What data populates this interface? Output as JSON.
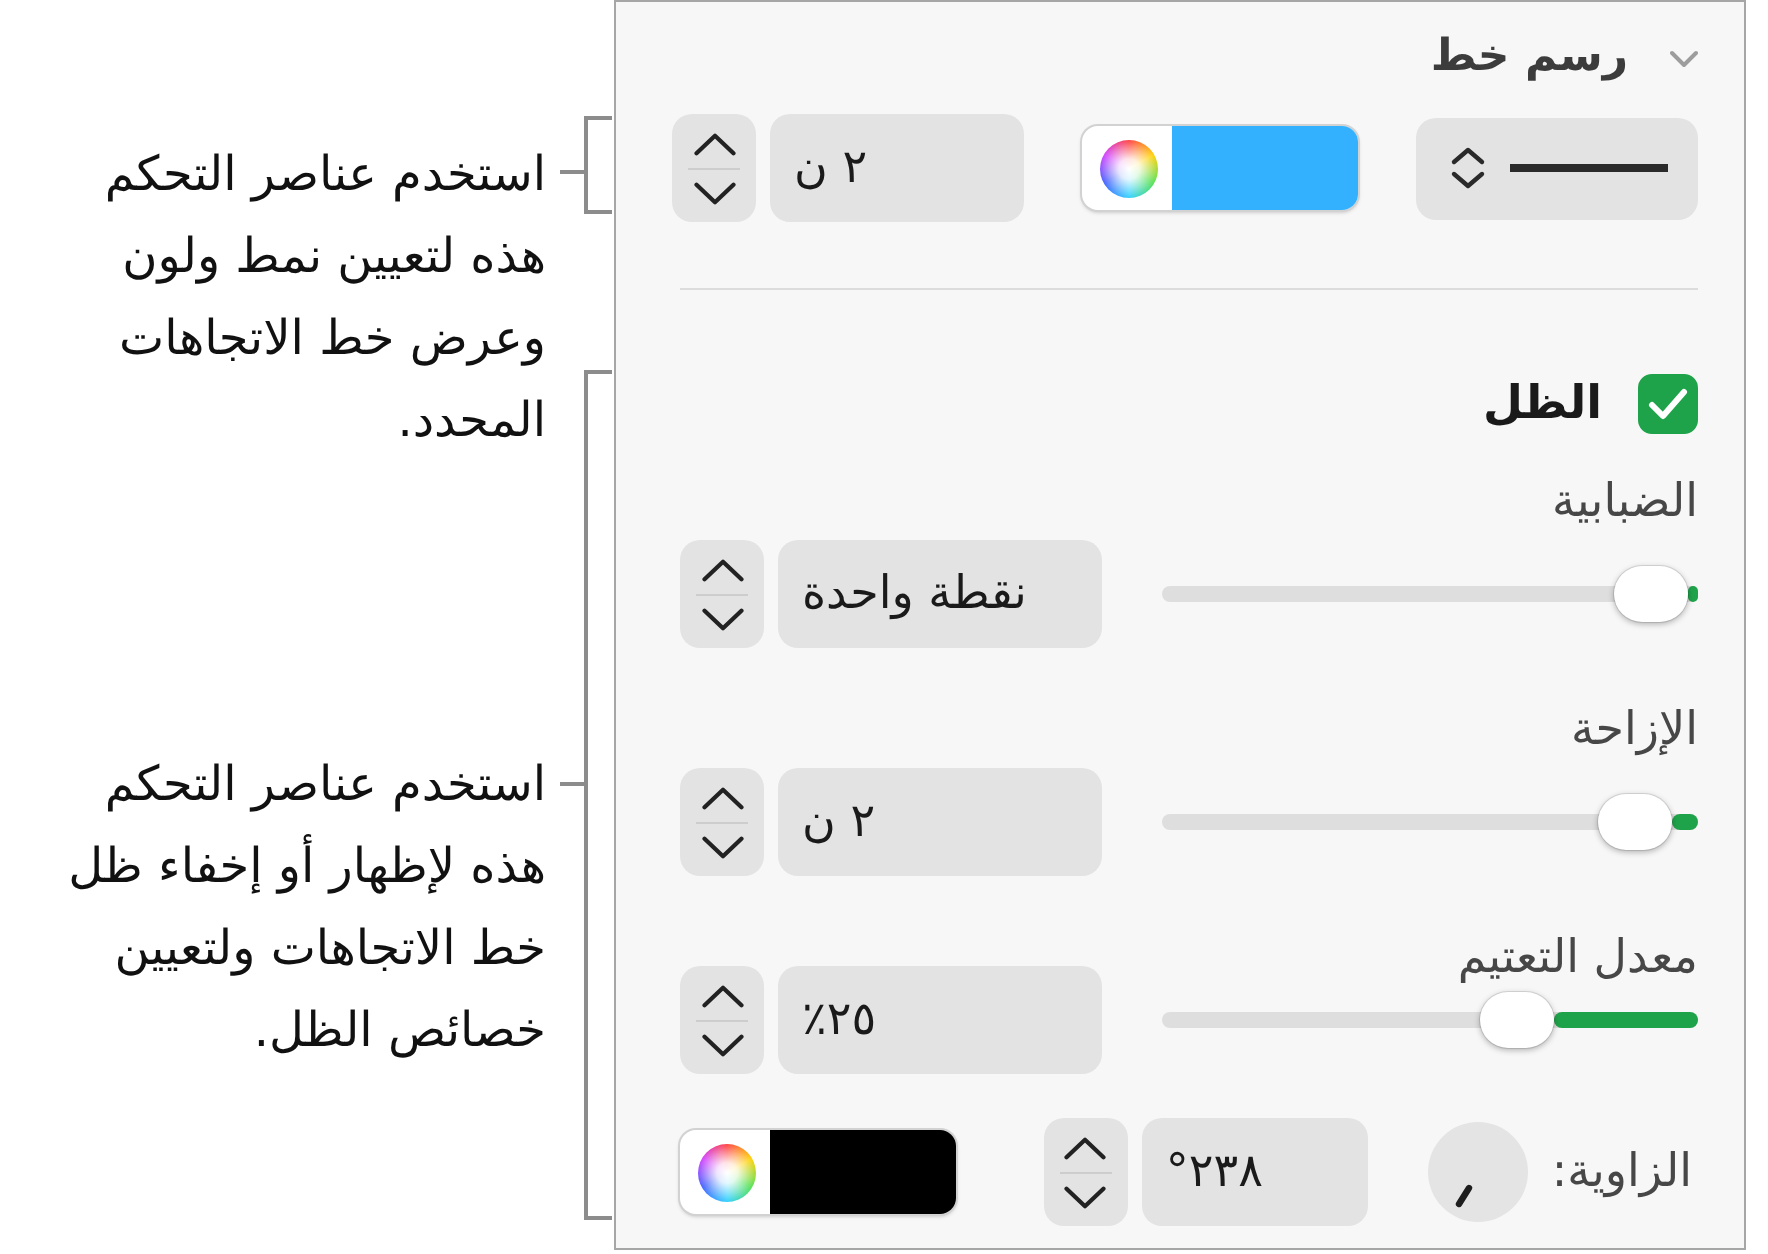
{
  "callouts": [
    {
      "text": "استخدم عناصر التحكم\nهذه لتعيين نمط ولون\nوعرض خط الاتجاهات\nالمحدد."
    },
    {
      "text": "استخدم عناصر التحكم\nهذه لإظهار أو إخفاء ظل\nخط الاتجاهات ولتعيين\nخصائص الظل."
    }
  ],
  "panel": {
    "section": {
      "title": "رسم خط",
      "expanded": true
    },
    "stroke": {
      "color": "#33b1ff",
      "width": "٢ ن"
    },
    "shadow": {
      "label": "الظل",
      "checked": true,
      "sliders": [
        {
          "label": "الضبابية",
          "level": 0.02,
          "value": "نقطة واحدة"
        },
        {
          "label": "الإزاحة",
          "level": 0.05,
          "value": "٢ ن"
        },
        {
          "label": "معدل التعتيم",
          "level": 0.27,
          "value": "٢٥٪"
        }
      ],
      "angle": {
        "label": "الزاوية:",
        "value": "٢٣٨°"
      },
      "color": "#000000"
    }
  }
}
